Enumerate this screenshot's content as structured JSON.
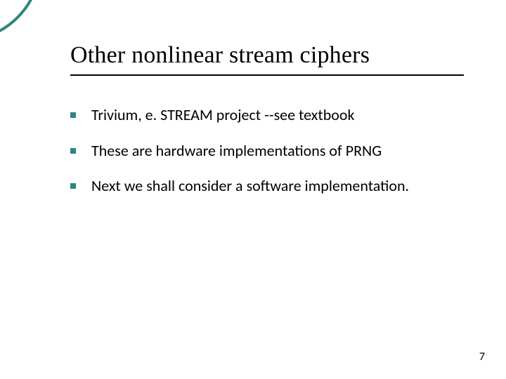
{
  "slide": {
    "title": "Other nonlinear stream ciphers",
    "bullets": [
      "Trivium,  e. STREAM project --see textbook",
      "These are hardware implementations of PRNG",
      "Next we shall consider a software implementation."
    ],
    "page_number": "7"
  },
  "theme": {
    "accent": "#2a8780"
  }
}
